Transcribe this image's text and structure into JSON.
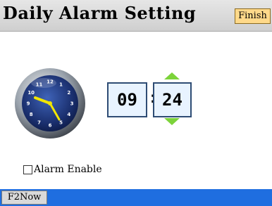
{
  "header": {
    "title": "Daily Alarm Setting",
    "finish_label": "Finish"
  },
  "alarm": {
    "hours": "09",
    "separator": ":",
    "minutes": "24",
    "enable_label": "Alarm Enable",
    "enabled": false
  },
  "clock_face": {
    "numbers": [
      "12",
      "1",
      "2",
      "3",
      "4",
      "5",
      "6",
      "7",
      "8",
      "9",
      "10",
      "11"
    ]
  },
  "footer": {
    "f2now_label": "F2Now"
  },
  "icons": {
    "hour_up": "chevron-up-icon",
    "minute_down": "chevron-down-icon",
    "clock": "analog-clock-icon"
  },
  "colors": {
    "footer_bar": "#1f6ee0",
    "finish_button": "#ffd98a",
    "arrow": "#7cd33a",
    "time_box_border": "#2e4c74",
    "clock_hands": "#f2e600"
  }
}
